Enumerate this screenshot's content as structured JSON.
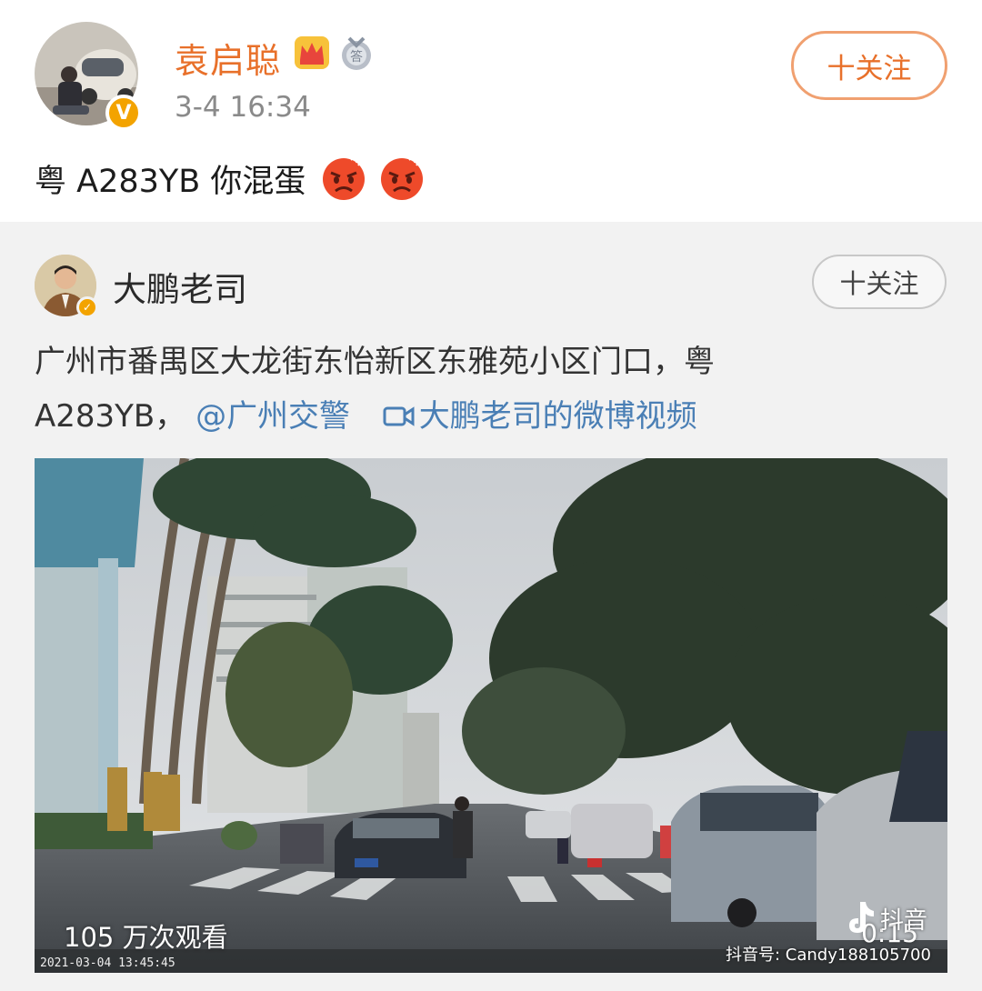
{
  "post": {
    "username": "袁启聪",
    "time": "3-4 16:34",
    "follow_label": "十关注",
    "verified_badge": "V",
    "text": "粤 A283YB 你混蛋",
    "emojis": [
      "angry-face-icon",
      "angry-face-icon"
    ],
    "icons": [
      "crown-icon",
      "medal-icon"
    ]
  },
  "repost": {
    "username": "大鹏老司",
    "follow_label": "十关注",
    "text_line1": "广州市番禺区大龙街东怡新区东雅苑小区门口，粤",
    "text_line2_prefix": "A283YB，",
    "mention": "@广州交警",
    "video_link_label": "大鹏老司的微博视频"
  },
  "video": {
    "view_count": "105 万次观看",
    "duration": "0:15",
    "dashcam_timestamp": "2021-03-04  13:45:45",
    "watermark_app": "抖音",
    "watermark_id": "抖音号: Candy188105700"
  },
  "colors": {
    "accent_orange": "#e8702a",
    "link_blue": "#4a7fb5",
    "card_background": "#f2f2f2"
  }
}
